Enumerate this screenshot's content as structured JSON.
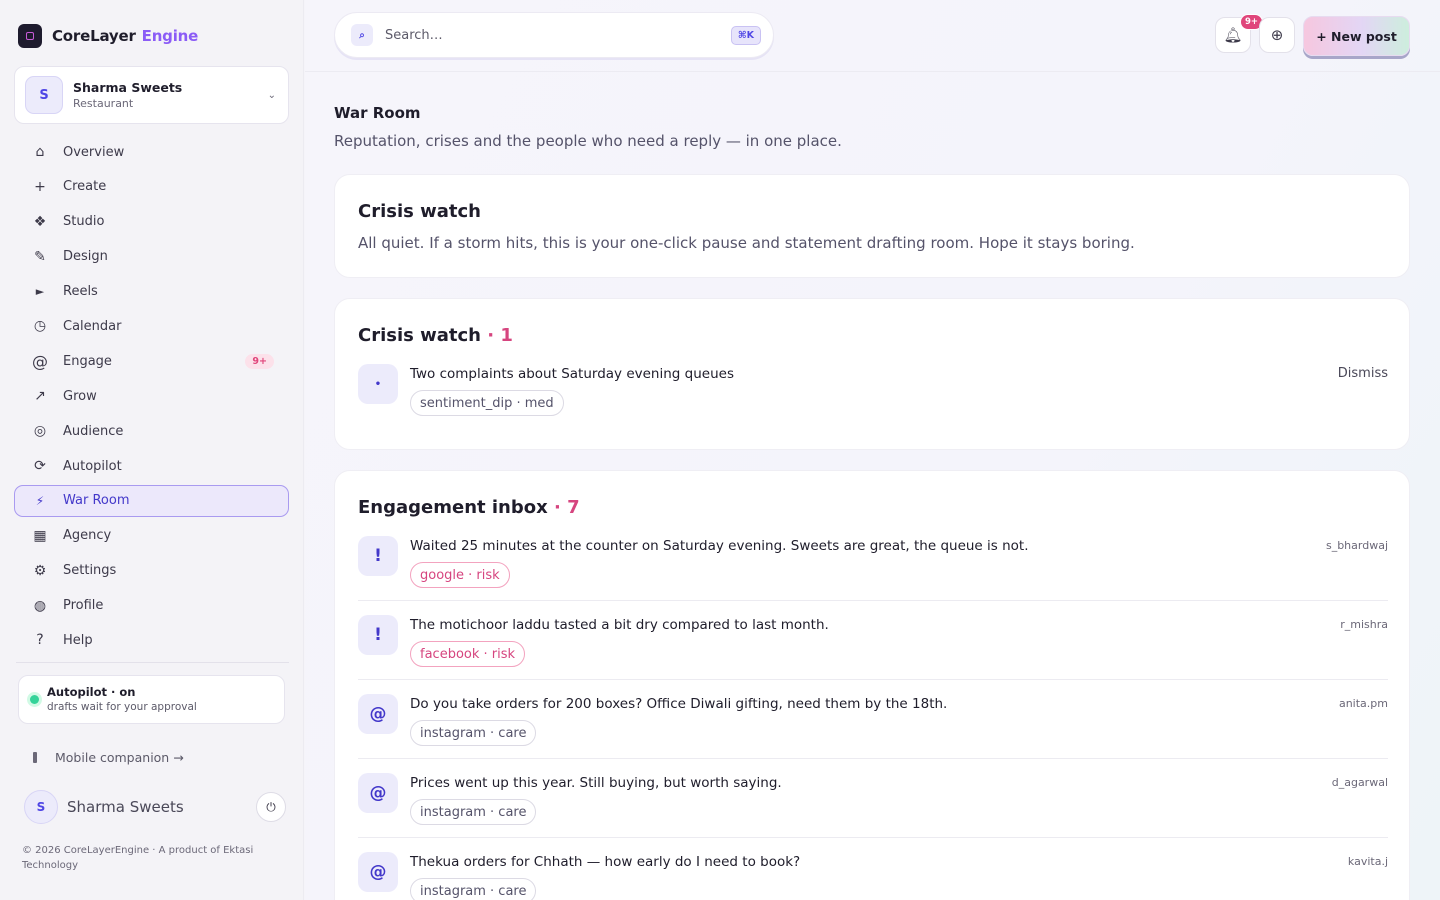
{
  "brand": {
    "name": "CoreLayer",
    "accent": "Engine"
  },
  "account": {
    "initial": "S",
    "name": "Sharma Sweets",
    "type": "Restaurant"
  },
  "nav": [
    {
      "icon": "home-icon",
      "glyph": "⌂",
      "label": "Overview"
    },
    {
      "icon": "plus-icon",
      "glyph": "+",
      "label": "Create"
    },
    {
      "icon": "studio-icon",
      "glyph": "❖",
      "label": "Studio"
    },
    {
      "icon": "pencil-icon",
      "glyph": "✎",
      "label": "Design"
    },
    {
      "icon": "play-icon",
      "glyph": "►",
      "label": "Reels"
    },
    {
      "icon": "clock-icon",
      "glyph": "◷",
      "label": "Calendar"
    },
    {
      "icon": "at-icon",
      "glyph": "@",
      "label": "Engage",
      "badge": "9+"
    },
    {
      "icon": "arrow-up-right-icon",
      "glyph": "↗",
      "label": "Grow"
    },
    {
      "icon": "target-icon",
      "glyph": "◎",
      "label": "Audience"
    },
    {
      "icon": "refresh-icon",
      "glyph": "⟳",
      "label": "Autopilot"
    },
    {
      "icon": "bolt-icon",
      "glyph": "⚡",
      "label": "War Room",
      "active": true
    },
    {
      "icon": "grid-icon",
      "glyph": "▦",
      "label": "Agency"
    },
    {
      "icon": "gear-icon",
      "glyph": "⚙",
      "label": "Settings"
    },
    {
      "icon": "profile-icon",
      "glyph": "◍",
      "label": "Profile"
    },
    {
      "icon": "help-icon",
      "glyph": "?",
      "label": "Help"
    }
  ],
  "autopilot": {
    "title": "Autopilot · on",
    "subtitle": "drafts wait for your approval"
  },
  "mobile_link": "Mobile companion →",
  "user": {
    "initial": "S",
    "name": "Sharma Sweets"
  },
  "footer": "© 2026 CoreLayerEngine · A product of Ektasi Technology",
  "search": {
    "placeholder": "Search…",
    "shortcut": "⌘K"
  },
  "notifications": {
    "badge": "9+"
  },
  "new_post_label": "+ New post",
  "page": {
    "title": "War Room",
    "subtitle": "Reputation, crises and the people who need a reply — in one place."
  },
  "crisis_status": {
    "title": "Crisis watch",
    "description": "All quiet. If a storm hits, this is your one-click pause and statement drafting room. Hope it stays boring."
  },
  "crisis_list": {
    "title": "Crisis watch",
    "count": "· 1",
    "items": [
      {
        "icon": "•",
        "text": "Two complaints about Saturday evening queues",
        "tag": "sentiment_dip · med",
        "action": "Dismiss"
      }
    ]
  },
  "inbox": {
    "title": "Engagement inbox",
    "count": "· 7",
    "items": [
      {
        "icon": "!",
        "text": "Waited 25 minutes at the counter on Saturday evening. Sweets are great, the queue is not.",
        "tag": "google · risk",
        "kind": "risk",
        "author": "s_bhardwaj"
      },
      {
        "icon": "!",
        "text": "The motichoor laddu tasted a bit dry compared to last month.",
        "tag": "facebook · risk",
        "kind": "risk",
        "author": "r_mishra"
      },
      {
        "icon": "@",
        "text": "Do you take orders for 200 boxes? Office Diwali gifting, need them by the 18th.",
        "tag": "instagram · care",
        "kind": "care",
        "author": "anita.pm"
      },
      {
        "icon": "@",
        "text": "Prices went up this year. Still buying, but worth saying.",
        "tag": "instagram · care",
        "kind": "care",
        "author": "d_agarwal"
      },
      {
        "icon": "@",
        "text": "Thekua orders for Chhath — how early do I need to book?",
        "tag": "instagram · care",
        "kind": "care",
        "author": "kavita.j"
      }
    ]
  },
  "colors": {
    "accent": "#8b5cf6",
    "active_nav": "#ece8fb",
    "risk": "#d6457f",
    "badge": "#e0457b",
    "online": "#34d399"
  }
}
